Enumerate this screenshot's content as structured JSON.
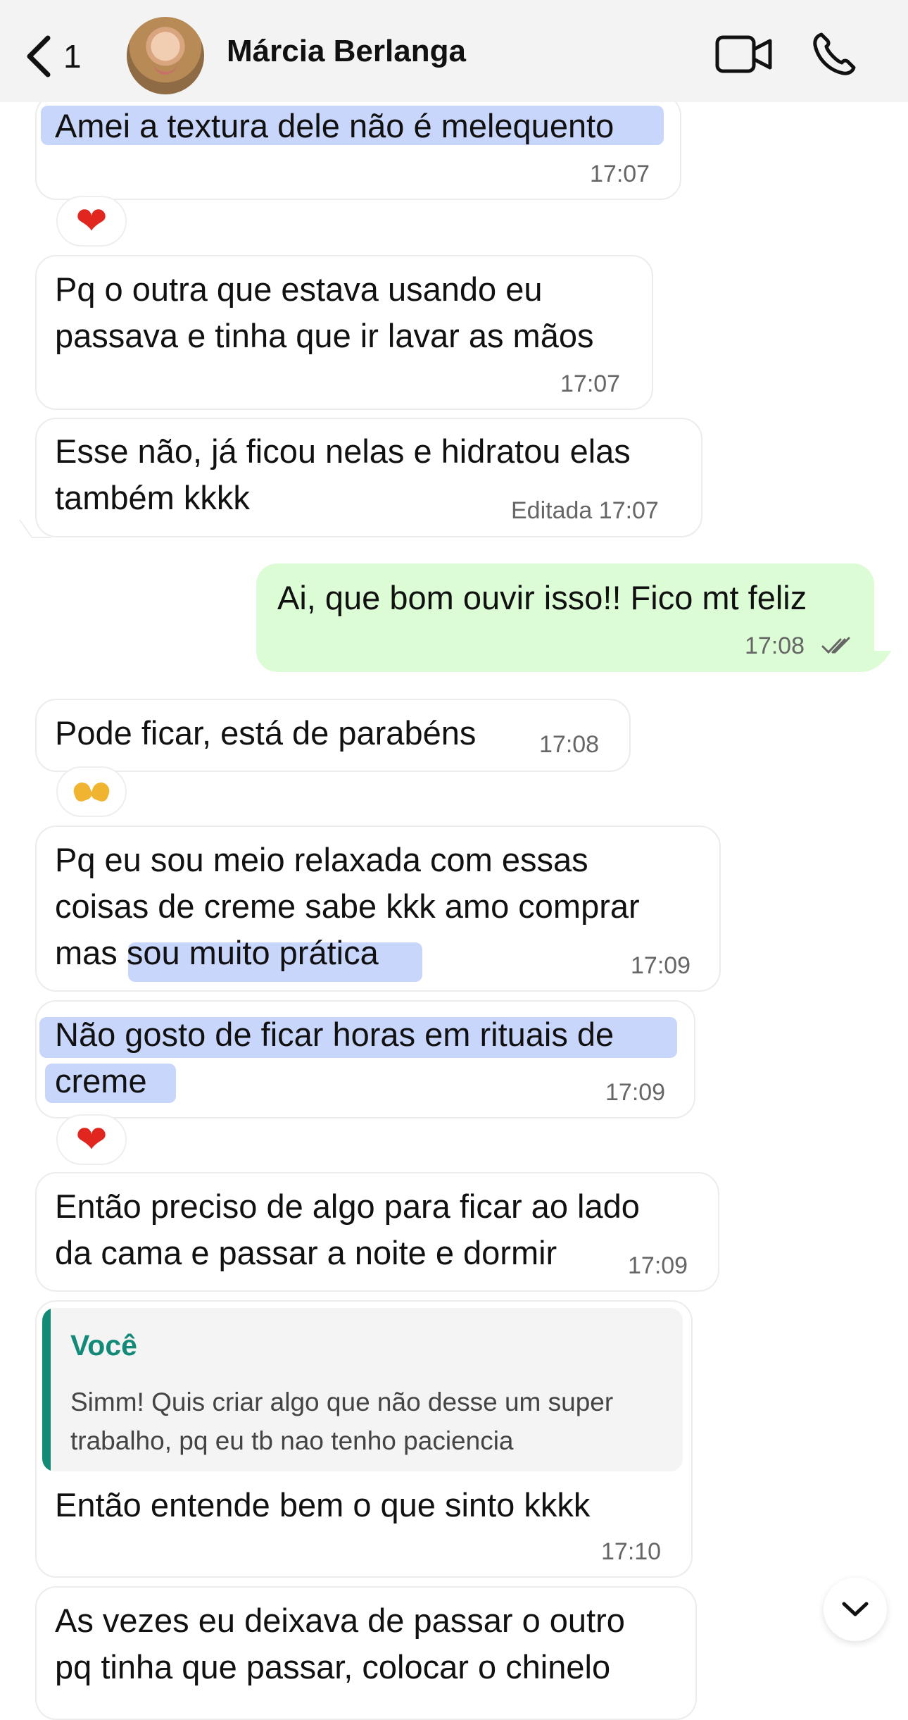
{
  "header": {
    "back_label": "1",
    "contact_name": "Márcia Berlanga"
  },
  "messages": [
    {
      "text_lines": [
        "Amei a textura dele não é melequento"
      ],
      "time": "17:07",
      "direction": "incoming",
      "highlighted": true
    },
    {
      "text_lines": [
        "Pq o outra que estava usando eu",
        "passava e tinha que ir lavar as mãos"
      ],
      "time": "17:07",
      "direction": "incoming"
    },
    {
      "text_lines": [
        "Esse não, já ficou nelas e hidratou elas",
        "também kkkk"
      ],
      "time": "Editada 17:07",
      "direction": "incoming"
    },
    {
      "text_lines": [
        "Ai, que bom ouvir isso!! Fico mt feliz"
      ],
      "time": "17:08",
      "direction": "outgoing",
      "status": "read"
    },
    {
      "text_lines": [
        "Pode ficar, está de parabéns"
      ],
      "time": "17:08",
      "direction": "incoming"
    },
    {
      "text_lines": [
        "Pq eu sou meio relaxada com essas",
        "coisas de creme sabe kkk amo comprar",
        "mas sou muito prática"
      ],
      "time": "17:09",
      "direction": "incoming"
    },
    {
      "text_lines": [
        "Não gosto de ficar horas em rituais de",
        "creme"
      ],
      "time": "17:09",
      "direction": "incoming",
      "highlighted": true
    },
    {
      "text_lines": [
        "Então preciso de algo para ficar ao lado",
        "da cama e passar a noite e dormir"
      ],
      "time": "17:09",
      "direction": "incoming"
    },
    {
      "quote": {
        "author": "Você",
        "text_lines": [
          "Simm! Quis criar algo que não desse um super",
          "trabalho, pq eu tb nao tenho paciencia"
        ]
      },
      "text_lines": [
        "Então entende bem o que sinto kkkk"
      ],
      "time": "17:10",
      "direction": "incoming"
    },
    {
      "text_lines": [
        "As vezes eu deixava de passar o outro",
        "pq tinha que passar, colocar o chinelo"
      ],
      "direction": "incoming"
    }
  ],
  "reactions": [
    {
      "emoji": "❤",
      "icon": "heart-icon"
    },
    {
      "emoji": "🫶",
      "icon": "heart-hands-icon"
    },
    {
      "emoji": "❤",
      "icon": "heart-icon"
    }
  ],
  "colors": {
    "header_bg": "#f3f3f3",
    "incoming_bubble": "#ffffff",
    "outgoing_bubble": "#dcfcd6",
    "highlight": "#c5d4fb",
    "quote_accent": "#138a78",
    "heart": "#e0261f"
  }
}
